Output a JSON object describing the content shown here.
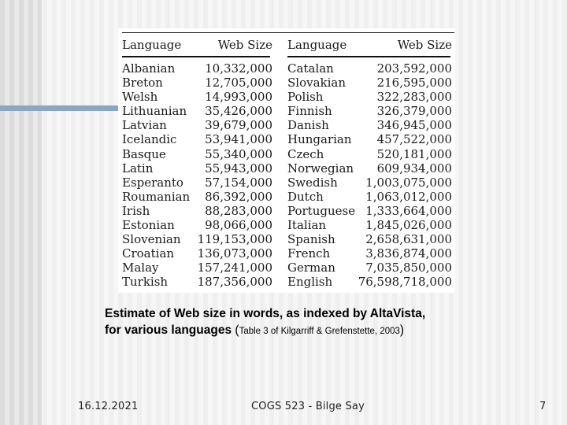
{
  "slide": {
    "page_number": "7",
    "footer_date": "16.12.2021",
    "footer_title": "COGS 523 - Bilge Say",
    "accent_color": "#8ea7c1"
  },
  "table": {
    "headers": {
      "language": "Language",
      "web_size": "Web Size"
    },
    "left_rows": [
      {
        "language": "Albanian",
        "web_size": "10,332,000"
      },
      {
        "language": "Breton",
        "web_size": "12,705,000"
      },
      {
        "language": "Welsh",
        "web_size": "14,993,000"
      },
      {
        "language": "Lithuanian",
        "web_size": "35,426,000"
      },
      {
        "language": "Latvian",
        "web_size": "39,679,000"
      },
      {
        "language": "Icelandic",
        "web_size": "53,941,000"
      },
      {
        "language": "Basque",
        "web_size": "55,340,000"
      },
      {
        "language": "Latin",
        "web_size": "55,943,000"
      },
      {
        "language": "Esperanto",
        "web_size": "57,154,000"
      },
      {
        "language": "Roumanian",
        "web_size": "86,392,000"
      },
      {
        "language": "Irish",
        "web_size": "88,283,000"
      },
      {
        "language": "Estonian",
        "web_size": "98,066,000"
      },
      {
        "language": "Slovenian",
        "web_size": "119,153,000"
      },
      {
        "language": "Croatian",
        "web_size": "136,073,000"
      },
      {
        "language": "Malay",
        "web_size": "157,241,000"
      },
      {
        "language": "Turkish",
        "web_size": "187,356,000"
      }
    ],
    "right_rows": [
      {
        "language": "Catalan",
        "web_size": "203,592,000"
      },
      {
        "language": "Slovakian",
        "web_size": "216,595,000"
      },
      {
        "language": "Polish",
        "web_size": "322,283,000"
      },
      {
        "language": "Finnish",
        "web_size": "326,379,000"
      },
      {
        "language": "Danish",
        "web_size": "346,945,000"
      },
      {
        "language": "Hungarian",
        "web_size": "457,522,000"
      },
      {
        "language": "Czech",
        "web_size": "520,181,000"
      },
      {
        "language": "Norwegian",
        "web_size": "609,934,000"
      },
      {
        "language": "Swedish",
        "web_size": "1,003,075,000"
      },
      {
        "language": "Dutch",
        "web_size": "1,063,012,000"
      },
      {
        "language": "Portuguese",
        "web_size": "1,333,664,000"
      },
      {
        "language": "Italian",
        "web_size": "1,845,026,000"
      },
      {
        "language": "Spanish",
        "web_size": "2,658,631,000"
      },
      {
        "language": "French",
        "web_size": "3,836,874,000"
      },
      {
        "language": "German",
        "web_size": "7,035,850,000"
      },
      {
        "language": "English",
        "web_size": "76,598,718,000"
      }
    ]
  },
  "caption": {
    "line1": "Estimate of Web size in words, as indexed by AltaVista,",
    "line2_bold": "for various languages ",
    "paren_open": "(",
    "citation": "Table 3 of Kilgarriff & Grefenstette, 2003",
    "paren_close": ")"
  }
}
